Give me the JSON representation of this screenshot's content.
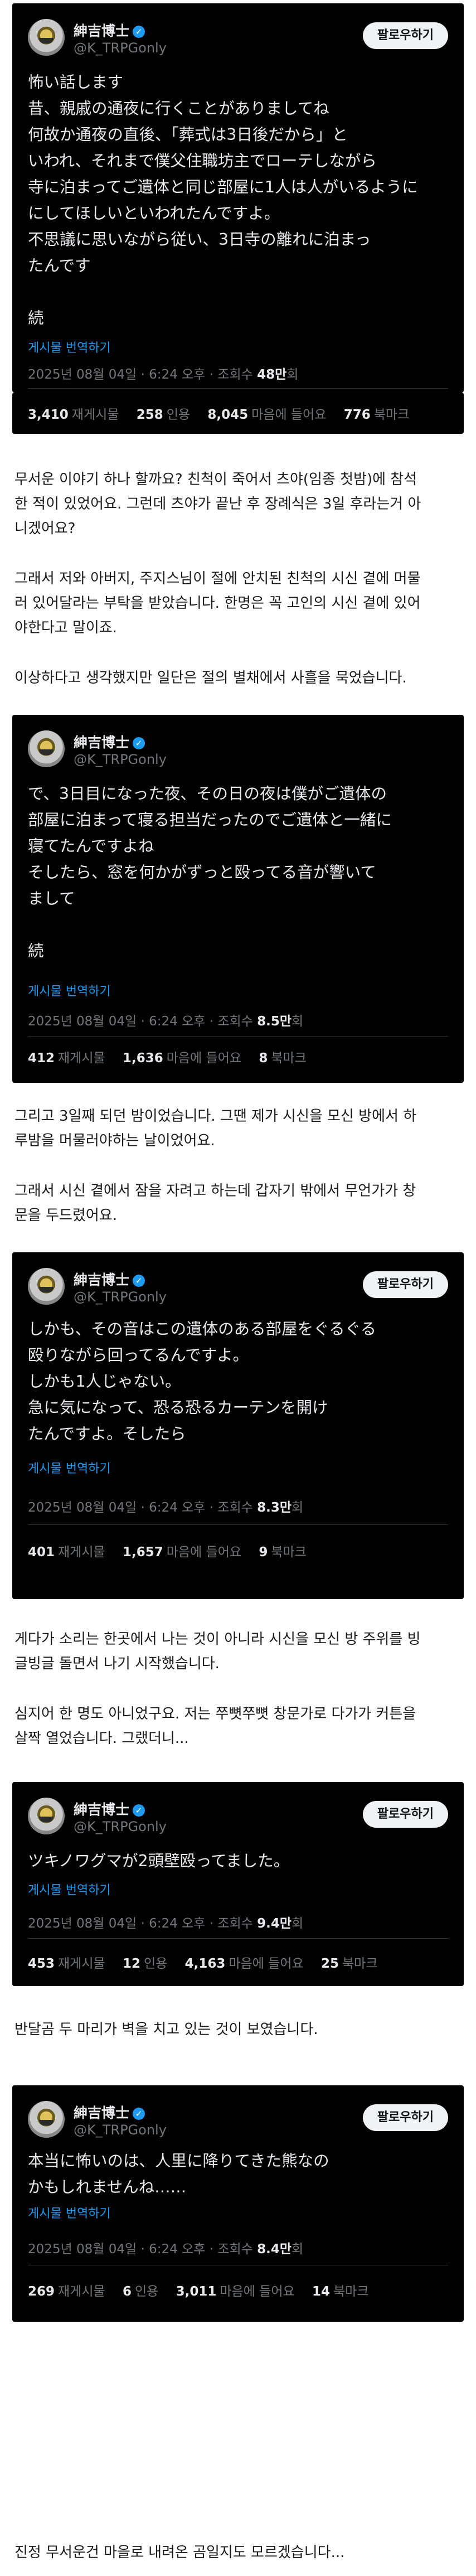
{
  "user": {
    "name": "紳吉博士",
    "handle": "@K_TRPGonly",
    "follow_label": "팔로우하기",
    "verified_mark": "✓"
  },
  "translate_label": "게시물 번역하기",
  "tweets": [
    {
      "text": "怖い話します\n昔、親戚の通夜に行くことがありましてね\n何故か通夜の直後、「葬式は3日後だから」と\nいわれ、それまで僕父住職坊主でローテしながら\n寺に泊まってご遺体と同じ部屋に1人は人がいるように\nにしてほしいといわれたんですよ。\n不思議に思いながら従い、3日寺の離れに泊まっ\nたんです\n\n続",
      "meta_prefix": "2025년 08월 04일 · 6:24 오후 · 조회수 ",
      "views": "48만",
      "views_suffix": "회",
      "stats": [
        {
          "num": "3,410",
          "label": "재게시물"
        },
        {
          "num": "258",
          "label": "인용"
        },
        {
          "num": "8,045",
          "label": "마음에 들어요"
        },
        {
          "num": "776",
          "label": "북마크"
        }
      ]
    },
    {
      "text": "で、3日目になった夜、その日の夜は僕がご遺体の\n部屋に泊まって寝る担当だったのでご遺体と一緒に\n寝てたんですよね\nそしたら、窓を何かがずっと殴ってる音が響いて\nまして\n\n続",
      "meta_prefix": "2025년 08월 04일 · 6:24 오후 · 조회수 ",
      "views": "8.5만",
      "views_suffix": "회",
      "stats": [
        {
          "num": "412",
          "label": "재게시물"
        },
        {
          "num": "1,636",
          "label": "마음에 들어요"
        },
        {
          "num": "8",
          "label": "북마크"
        }
      ]
    },
    {
      "text": "しかも、その音はこの遺体のある部屋をぐるぐる\n殴りながら回ってるんですよ。\nしかも1人じゃない。\n急に気になって、恐る恐るカーテンを開け\nたんですよ。そしたら",
      "meta_prefix": "2025년 08월 04일 · 6:24 오후 · 조회수 ",
      "views": "8.3만",
      "views_suffix": "회",
      "stats": [
        {
          "num": "401",
          "label": "재게시물"
        },
        {
          "num": "1,657",
          "label": "마음에 들어요"
        },
        {
          "num": "9",
          "label": "북마크"
        }
      ]
    },
    {
      "text": "ツキノワグマが2頭壁殴ってました。",
      "meta_prefix": "2025년 08월 04일 · 6:24 오후 · 조회수 ",
      "views": "9.4만",
      "views_suffix": "회",
      "stats": [
        {
          "num": "453",
          "label": "재게시물"
        },
        {
          "num": "12",
          "label": "인용"
        },
        {
          "num": "4,163",
          "label": "마음에 들어요"
        },
        {
          "num": "25",
          "label": "북마크"
        }
      ]
    },
    {
      "text": "本当に怖いのは、人里に降りてきた熊なの\nかもしれませんね……",
      "meta_prefix": "2025년 08월 04일 · 6:24 오후 · 조회수 ",
      "views": "8.4만",
      "views_suffix": "회",
      "stats": [
        {
          "num": "269",
          "label": "재게시물"
        },
        {
          "num": "6",
          "label": "인용"
        },
        {
          "num": "3,011",
          "label": "마음에 들어요"
        },
        {
          "num": "14",
          "label": "북마크"
        }
      ]
    }
  ],
  "paragraphs": [
    "무서운 이야기 하나 할까요? 친척이 죽어서 츠야(임종 첫밤)에 참석\n한 적이 있었어요. 그런데 츠야가 끝난 후 장례식은 3일 후라는거 아\n니겠어요?",
    "그래서 저와 아버지, 주지스님이 절에 안치된 친척의 시신 곁에 머물\n러 있어달라는 부탁을 받았습니다. 한명은 꼭 고인의 시신 곁에 있어\n야한다고 말이죠.",
    "이상하다고 생각했지만 일단은 절의 별채에서 사흘을 묵었습니다.",
    "그리고 3일째 되던 밤이었습니다. 그땐 제가 시신을 모신 방에서 하\n루밤을 머물러야하는 날이었어요.",
    "그래서 시신 곁에서 잠을 자려고 하는데 갑자기 밖에서 무언가가 창\n문을 두드렸어요.",
    "게다가 소리는 한곳에서 나는 것이 아니라 시신을 모신 방 주위를 빙\n글빙글 돌면서 나기 시작했습니다.",
    "심지어 한 명도 아니었구요. 저는 쭈뼛쭈뼛 창문가로 다가가 커튼을\n살짝 열었습니다. 그랬더니...",
    "반달곰 두 마리가 벽을 치고 있는 것이 보였습니다.",
    "진정 무서운건 마을로 내려온 곰일지도 모르겠습니다..."
  ]
}
